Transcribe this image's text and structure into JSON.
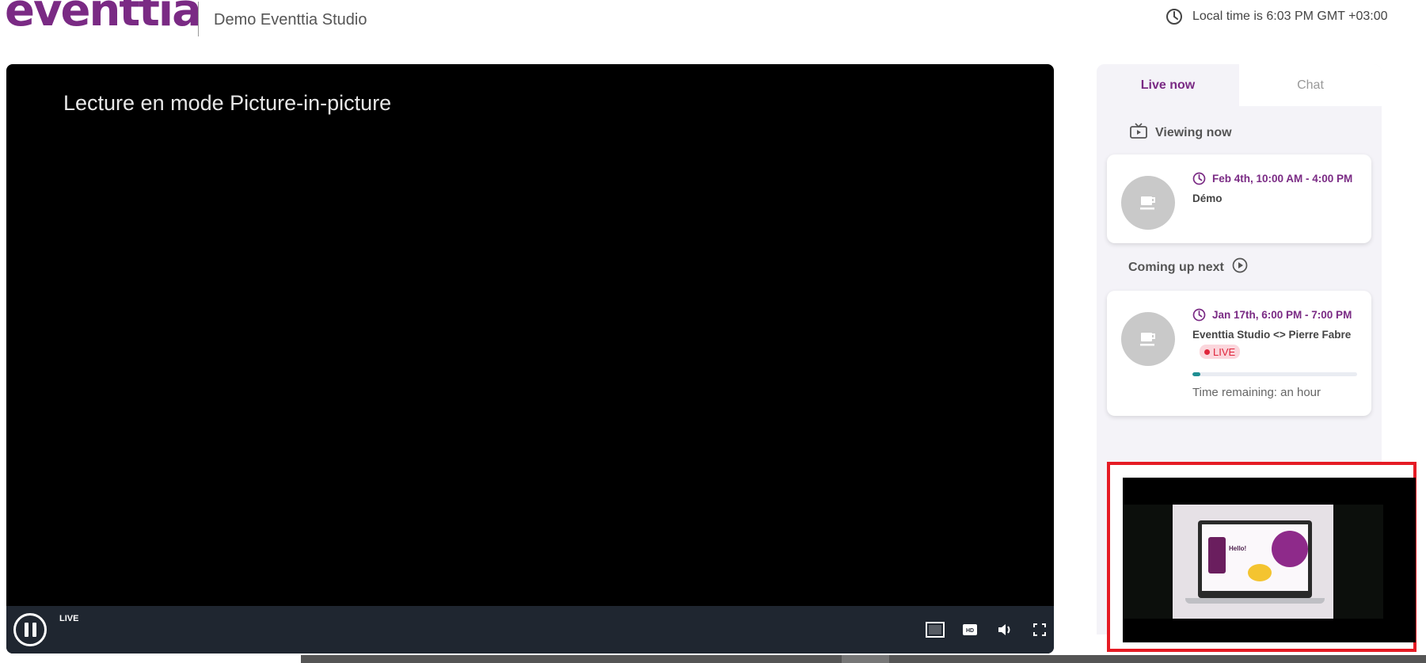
{
  "header": {
    "logo_text": "eventtia",
    "studio_name": "Demo Eventtia Studio",
    "local_time": "Local time is 6:03 PM GMT +03:00"
  },
  "video": {
    "pip_message": "Lecture en mode Picture-in-picture",
    "live_label": "LIVE"
  },
  "panel": {
    "tabs": [
      {
        "label": "Live now",
        "active": true
      },
      {
        "label": "Chat",
        "active": false
      }
    ],
    "viewing_now_title": "Viewing now",
    "coming_up_next_title": "Coming up next",
    "viewing_now": {
      "time": "Feb 4th, 10:00 AM - 4:00 PM",
      "title": "Démo"
    },
    "coming_up": {
      "time": "Jan 17th, 6:00 PM - 7:00 PM",
      "title": "Eventtia Studio <> Pierre Fabre",
      "badge": "LIVE",
      "progress": 0.05,
      "time_remaining": "Time remaining: an hour"
    }
  },
  "pip": {
    "slide_text": "Hello!"
  },
  "colors": {
    "brand": "#7a2a84",
    "live_red": "#e0253b",
    "progress": "#1f8e92",
    "pip_border": "#e51b24"
  }
}
